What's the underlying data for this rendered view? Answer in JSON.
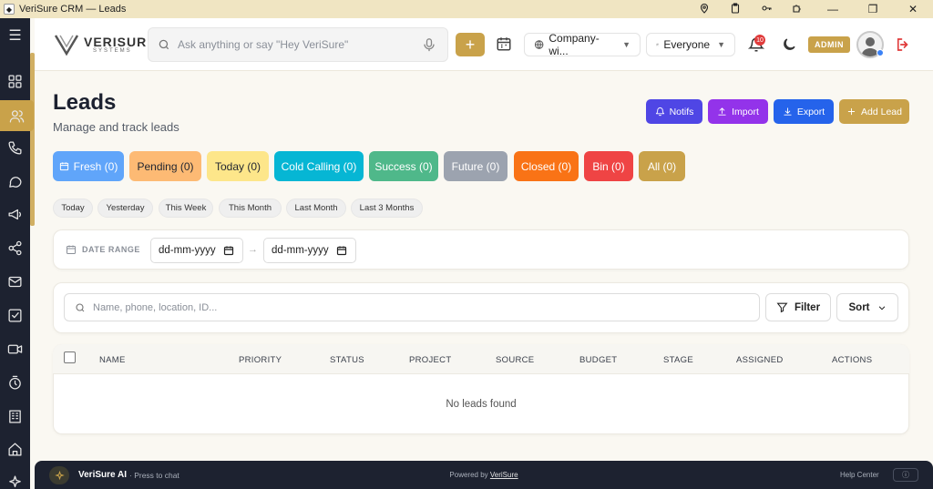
{
  "window": {
    "title": "VeriSure CRM — Leads",
    "minimize_glyph": "—",
    "maximize_glyph": "❐",
    "close_glyph": "✕",
    "tray_icons": [
      "location-pin-icon",
      "clipboard-icon",
      "key-icon",
      "puzzle-icon"
    ]
  },
  "sidebar": {
    "menu_glyph": "☰",
    "items": [
      "dashboard-grid-icon",
      "users-icon",
      "phone-icon",
      "chat-icon",
      "megaphone-icon",
      "share-icon",
      "mail-icon",
      "task-check-icon",
      "video-icon",
      "timer-icon",
      "building-icon",
      "home-icon",
      "sparkle-icon"
    ],
    "active": "users-icon",
    "accent_color": "#c9a24a"
  },
  "header": {
    "logo_name": "VERISURE",
    "logo_sub": "SYSTEMS",
    "search_placeholder": "Ask anything or say \"Hey VeriSure\"",
    "add_glyph": "+",
    "scope_select": "Company-wi...",
    "people_select": "Everyone",
    "notification_count": "10",
    "role_badge": "ADMIN"
  },
  "page": {
    "title": "Leads",
    "subtitle": "Manage and track leads"
  },
  "actions": [
    {
      "label": "Notifs",
      "color": "#4f46e5",
      "icon": "bell-icon"
    },
    {
      "label": "Import",
      "color": "#9333ea",
      "icon": "upload-icon"
    },
    {
      "label": "Export",
      "color": "#2563eb",
      "icon": "download-icon"
    },
    {
      "label": "Add Lead",
      "color": "#c9a24a",
      "icon": "plus-icon"
    }
  ],
  "status_filters": [
    {
      "label": "Fresh (0)",
      "bg": "#60a5fa",
      "fg": "#ffffff"
    },
    {
      "label": "Pending (0)",
      "bg": "#fdba74",
      "fg": "#1f2430"
    },
    {
      "label": "Today (0)",
      "bg": "#fde68a",
      "fg": "#1f2430"
    },
    {
      "label": "Cold Calling (0)",
      "bg": "#06b6d4",
      "fg": "#ffffff"
    },
    {
      "label": "Success (0)",
      "bg": "#4fb88a",
      "fg": "#ffffff"
    },
    {
      "label": "Future (0)",
      "bg": "#9ca3af",
      "fg": "#ffffff"
    },
    {
      "label": "Closed (0)",
      "bg": "#f97316",
      "fg": "#ffffff"
    },
    {
      "label": "Bin (0)",
      "bg": "#ef4444",
      "fg": "#ffffff"
    },
    {
      "label": "All (0)",
      "bg": "#c9a24a",
      "fg": "#ffffff"
    }
  ],
  "date_chips": [
    "Today",
    "Yesterday",
    "This Week",
    "This Month",
    "Last Month",
    "Last 3 Months"
  ],
  "date_range": {
    "label": "DATE RANGE",
    "from": "dd-mm-yyyy",
    "to": "dd-mm-yyyy",
    "arrow": "→"
  },
  "lead_search": {
    "placeholder": "Name, phone, location, ID...",
    "filter_label": "Filter",
    "sort_label": "Sort"
  },
  "table": {
    "columns": [
      "NAME",
      "PRIORITY",
      "STATUS",
      "PROJECT",
      "SOURCE",
      "BUDGET",
      "STAGE",
      "ASSIGNED",
      "ACTIONS"
    ],
    "empty_text": "No leads found"
  },
  "footer": {
    "ai_name": "VeriSure AI",
    "ai_hint": "· Press to chat",
    "powered_prefix": "Powered by ",
    "powered_brand": "VeriSure",
    "help": "Help Center",
    "info_glyph": "ⓘ"
  }
}
